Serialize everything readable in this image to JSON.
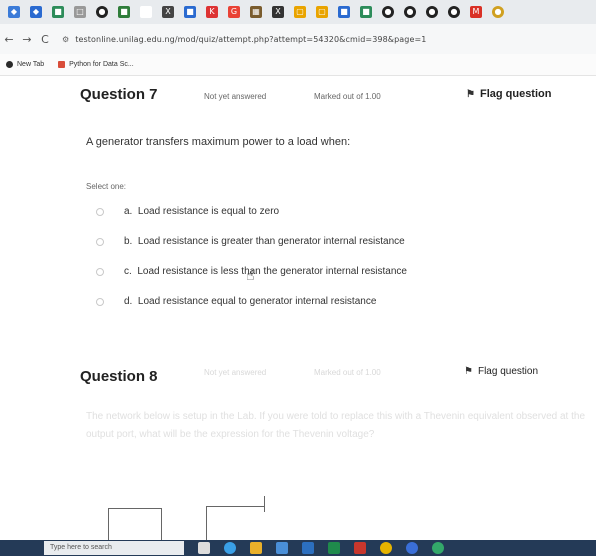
{
  "browser": {
    "url": "testonline.unilag.edu.ng/mod/quiz/attempt.php?attempt=54320&cmid=398&page=1",
    "bookmarks": [
      {
        "label": "New Tab"
      },
      {
        "label": "Python for Data Sc..."
      }
    ]
  },
  "question7": {
    "title": "Question 7",
    "status": "Not yet answered",
    "marks": "Marked out of 1.00",
    "flag_label": "Flag question",
    "text": "A generator transfers maximum power to a load when:",
    "select_label": "Select one:",
    "options": [
      {
        "letter": "a.",
        "text": "Load resistance is equal to zero"
      },
      {
        "letter": "b.",
        "text": "Load resistance is greater than generator internal resistance"
      },
      {
        "letter": "c.",
        "text": "Load resistance is less than the generator internal resistance"
      },
      {
        "letter": "d.",
        "text": "Load resistance equal to generator internal resistance"
      }
    ]
  },
  "question8": {
    "title": "Question 8",
    "status": "Not yet answered",
    "marks": "Marked out of 1.00",
    "flag_label": "Flag question",
    "text": "The network below is setup in the Lab. If you were told to replace this with a Thevenin equivalent observed at the output port, what will be the expression for the Thevenin voltage?"
  },
  "taskbar": {
    "search_placeholder": "Type here to search"
  },
  "colors": {
    "tab_strip": "#e8ebee",
    "taskbar": "#243a57",
    "accent_blue": "#1a73e8"
  }
}
